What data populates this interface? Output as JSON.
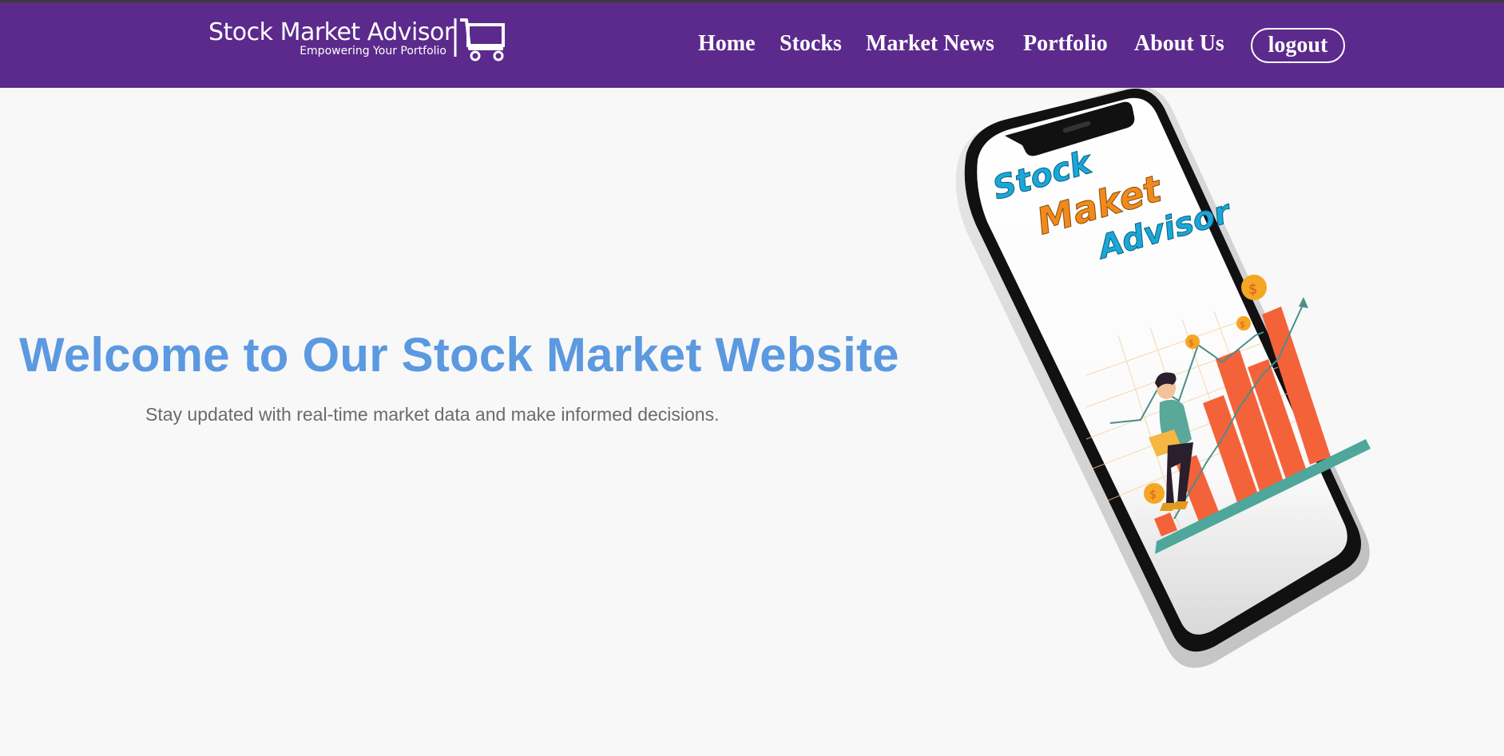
{
  "header": {
    "logo": {
      "title": "Stock Market Advisor",
      "subtitle": "Empowering Your Portfolio",
      "icon": "cart-icon"
    },
    "nav": {
      "home": "Home",
      "stocks": "Stocks",
      "market_news": "Market News",
      "portfolio": "Portfolio",
      "about_us": "About Us"
    },
    "logout_label": "logout"
  },
  "hero": {
    "title": "Welcome to Our Stock Market Website",
    "subtitle": "Stay updated with real-time market data and make informed decisions.",
    "image": {
      "subject": "phone-illustration",
      "text_line_1": "Stock",
      "text_line_2": "Maket",
      "text_line_3": "Advisor",
      "coin_symbol": "$"
    }
  },
  "colors": {
    "navbar": "#5b2a8c",
    "hero_title": "#5b99e0",
    "hero_subtitle": "#6b6b6b",
    "background": "#f8f8f8",
    "bars": "#f4623a",
    "phone_text_blue": "#1aa7d8",
    "phone_text_orange": "#f08a1c",
    "platform": "#4ea79a"
  }
}
